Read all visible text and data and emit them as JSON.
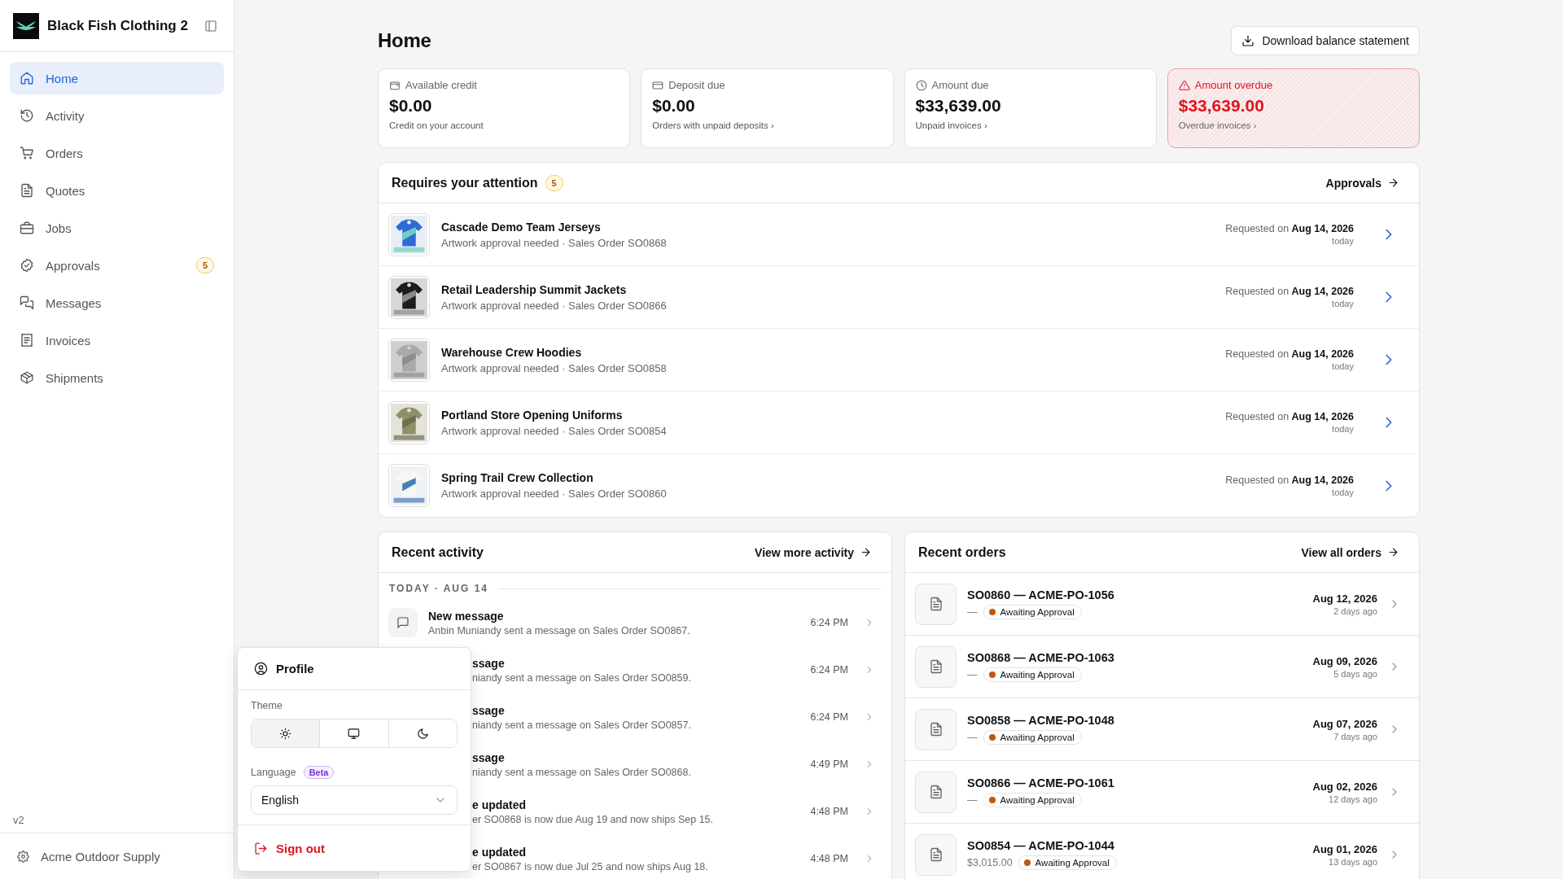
{
  "sidebar": {
    "brand": "Black Fish Clothing 2",
    "items": [
      {
        "label": "Home",
        "selected": true
      },
      {
        "label": "Activity",
        "selected": false
      },
      {
        "label": "Orders",
        "selected": false
      },
      {
        "label": "Quotes",
        "selected": false
      },
      {
        "label": "Jobs",
        "selected": false
      },
      {
        "label": "Approvals",
        "selected": false,
        "badge": "5"
      },
      {
        "label": "Messages",
        "selected": false
      },
      {
        "label": "Invoices",
        "selected": false
      },
      {
        "label": "Shipments",
        "selected": false
      }
    ],
    "version": "v2",
    "account": "Acme Outdoor Supply"
  },
  "page": {
    "title": "Home",
    "action": "Download balance statement"
  },
  "summary_cards": [
    {
      "kind": "normal",
      "label": "Available credit",
      "amount": "$0.00",
      "note": "Credit on your account"
    },
    {
      "kind": "normal",
      "label": "Deposit due",
      "amount": "$0.00",
      "note": "Orders with unpaid deposits ›"
    },
    {
      "kind": "normal",
      "label": "Amount due",
      "amount": "$33,639.00",
      "note": "Unpaid invoices ›"
    },
    {
      "kind": "alert",
      "label": "Amount overdue",
      "amount": "$33,639.00",
      "note": "Overdue invoices ›"
    }
  ],
  "attention": {
    "title": "Requires your attention",
    "count": "5",
    "link": "Approvals",
    "rows": [
      {
        "title": "Cascade Demo Team Jerseys",
        "subtitle": "Artwork approval needed · Sales Order SO0868",
        "requested": "Requested on **Aug 14, 2026**",
        "relative": "today"
      },
      {
        "title": "Retail Leadership Summit Jackets",
        "subtitle": "Artwork approval needed · Sales Order SO0866",
        "requested": "Requested on **Aug 14, 2026**",
        "relative": "today"
      },
      {
        "title": "Warehouse Crew Hoodies",
        "subtitle": "Artwork approval needed · Sales Order SO0858",
        "requested": "Requested on **Aug 14, 2026**",
        "relative": "today"
      },
      {
        "title": "Portland Store Opening Uniforms",
        "subtitle": "Artwork approval needed · Sales Order SO0854",
        "requested": "Requested on **Aug 14, 2026**",
        "relative": "today"
      },
      {
        "title": "Spring Trail Crew Collection",
        "subtitle": "Artwork approval needed · Sales Order SO0860",
        "requested": "Requested on **Aug 14, 2026**",
        "relative": "today"
      }
    ]
  },
  "recent_activity": {
    "title": "Recent activity",
    "link": "View more activity",
    "group": "TODAY · AUG 14",
    "items": [
      {
        "kind": "full",
        "title": "New message",
        "detail": "Anbin Muniandy sent a message on Sales Order SO0867.",
        "time": "6:24 PM"
      },
      {
        "kind": "covered",
        "title": "ssage",
        "detail": "niandy sent a message on Sales Order SO0859.",
        "time": "6:24 PM"
      },
      {
        "kind": "covered",
        "title": "ssage",
        "detail": "niandy sent a message on Sales Order SO0857.",
        "time": "6:24 PM"
      },
      {
        "kind": "covered",
        "title": "ssage",
        "detail": "niandy sent a message on Sales Order SO0868.",
        "time": "4:49 PM"
      },
      {
        "kind": "covered",
        "title": "e updated",
        "detail": "er SO0868 is now due Aug 19 and now ships Sep 15.",
        "time": "4:48 PM"
      },
      {
        "kind": "covered",
        "title": "e updated",
        "detail": "er SO0867 is now due Jul 25 and now ships Aug 18.",
        "time": "4:48 PM"
      }
    ]
  },
  "recent_orders": {
    "title": "Recent orders",
    "link": "View all orders",
    "rows": [
      {
        "title": "SO0860 — ACME-PO-1056",
        "amount": "—",
        "status": "Awaiting Approval",
        "date": "Aug 12, 2026",
        "relative": "2 days ago"
      },
      {
        "title": "SO0868 — ACME-PO-1063",
        "amount": "—",
        "status": "Awaiting Approval",
        "date": "Aug 09, 2026",
        "relative": "5 days ago"
      },
      {
        "title": "SO0858 — ACME-PO-1048",
        "amount": "—",
        "status": "Awaiting Approval",
        "date": "Aug 07, 2026",
        "relative": "7 days ago"
      },
      {
        "title": "SO0866 — ACME-PO-1061",
        "amount": "—",
        "status": "Awaiting Approval",
        "date": "Aug 02, 2026",
        "relative": "12 days ago"
      },
      {
        "title": "SO0854 — ACME-PO-1044",
        "amount": "$3,015.00",
        "status": "Awaiting Approval",
        "date": "Aug 01, 2026",
        "relative": "13 days ago"
      }
    ]
  },
  "profile_menu": {
    "title": "Profile",
    "theme_label": "Theme",
    "theme_options": [
      {
        "kind": "light",
        "selected": true
      },
      {
        "kind": "system",
        "selected": false
      },
      {
        "kind": "dark",
        "selected": false
      }
    ],
    "language_label": "Language",
    "language_badge": "Beta",
    "language": "English",
    "sign_out": "Sign out"
  }
}
